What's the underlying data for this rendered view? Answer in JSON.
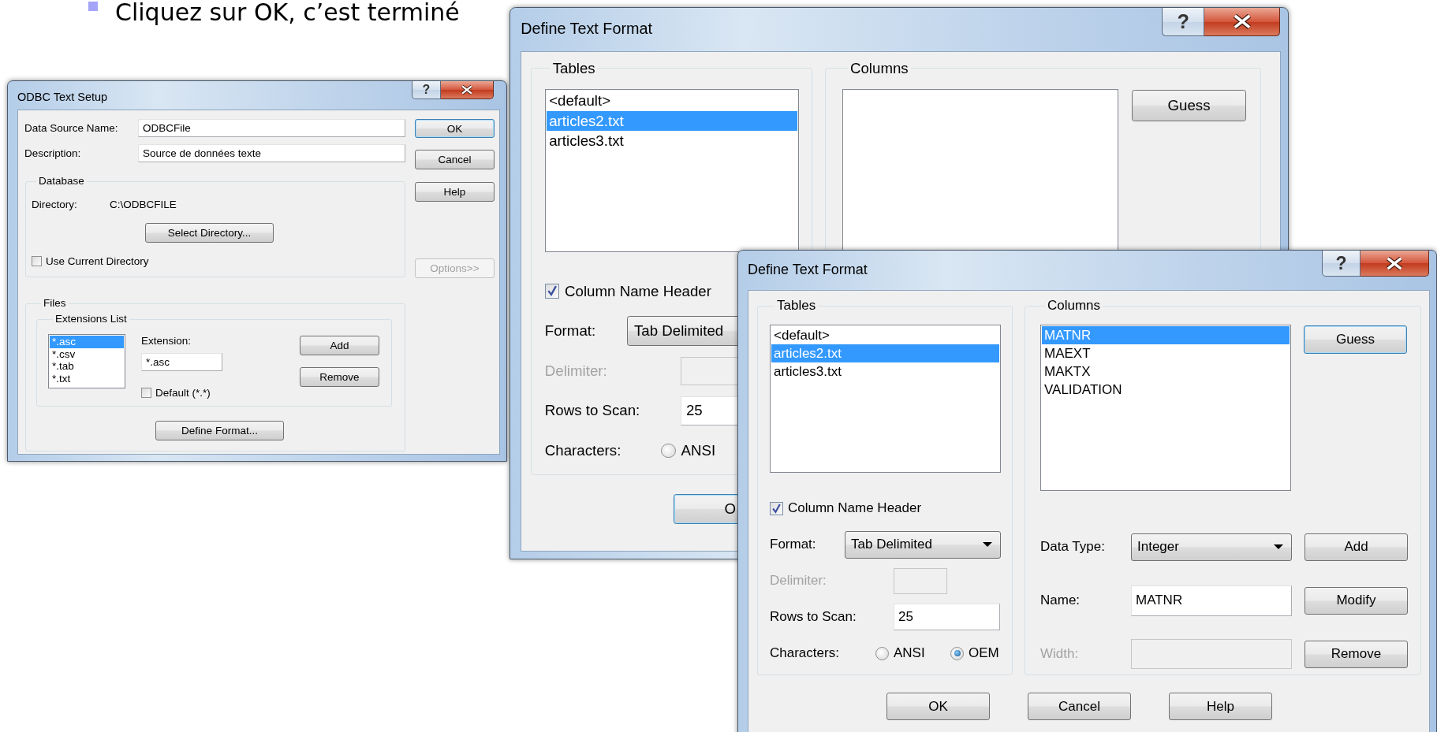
{
  "slide": {
    "bullet_text": "Cliquez sur OK, c’est terminé"
  },
  "odbc_setup": {
    "title": "ODBC Text Setup",
    "help_button": "?",
    "fields": [
      {
        "label": "Data Source Name:",
        "value": "ODBCFile"
      },
      {
        "label": "Description:",
        "value": "Source de données texte"
      }
    ],
    "database": {
      "title": "Database",
      "directory_label": "Directory:",
      "directory": "C:\\ODBCFILE",
      "select_button": {
        "label": "Select Directory...",
        "default": false,
        "disabled": false
      },
      "use_current_directory": {
        "label": "Use Current Directory",
        "checked": false
      }
    },
    "files": {
      "title": "Files",
      "extensions": {
        "title": "Extensions List",
        "items": [
          {
            "label": "*.asc",
            "selected": true
          },
          {
            "label": "*.csv",
            "selected": false
          },
          {
            "label": "*.tab",
            "selected": false
          },
          {
            "label": "*.txt",
            "selected": false
          }
        ],
        "extension_label": "Extension:",
        "extension_value": "*.asc",
        "default_option": {
          "label": "Default (*.*)",
          "checked": false
        },
        "buttons": [
          {
            "label": "Add",
            "default": false,
            "disabled": false
          },
          {
            "label": "Remove",
            "default": false,
            "disabled": false
          }
        ]
      },
      "define_button": {
        "label": "Define Format...",
        "default": false,
        "disabled": false
      }
    },
    "buttons": [
      {
        "label": "OK",
        "default": true,
        "disabled": false
      },
      {
        "label": "Cancel",
        "default": false,
        "disabled": false
      },
      {
        "label": "Help",
        "default": false,
        "disabled": false
      },
      {
        "label": "Options>>",
        "default": false,
        "disabled": true
      }
    ]
  },
  "format_dialog_back": {
    "title": "Define Text Format",
    "help_button": "?",
    "tables": {
      "title": "Tables",
      "items": [
        {
          "label": "<default>",
          "selected": false
        },
        {
          "label": "articles2.txt",
          "selected": true
        },
        {
          "label": "articles3.txt",
          "selected": false
        }
      ]
    },
    "columns": {
      "title": "Columns",
      "guess_button": {
        "label": "Guess",
        "default": false,
        "disabled": false
      }
    },
    "column_name_header": {
      "label": "Column Name Header",
      "checked": true
    },
    "format": {
      "label": "Format:",
      "value": "Tab Delimited"
    },
    "delimiter": {
      "label": "Delimiter:",
      "disabled": true
    },
    "rows_to_scan": {
      "label": "Rows to Scan:",
      "value": "25"
    },
    "characters": {
      "label": "Characters:",
      "options": [
        {
          "label": "ANSI",
          "selected": false
        }
      ]
    },
    "buttons": [
      {
        "label": "O",
        "default": true,
        "disabled": false
      }
    ]
  },
  "format_dialog_front": {
    "title": "Define Text Format",
    "help_button": "?",
    "tables": {
      "title": "Tables",
      "items": [
        {
          "label": "<default>",
          "selected": false
        },
        {
          "label": "articles2.txt",
          "selected": true
        },
        {
          "label": "articles3.txt",
          "selected": false
        }
      ]
    },
    "columns": {
      "title": "Columns",
      "items": [
        {
          "label": "MATNR",
          "selected": true
        },
        {
          "label": "MAEXT",
          "selected": false
        },
        {
          "label": "MAKTX",
          "selected": false
        },
        {
          "label": "VALIDATION",
          "selected": false
        }
      ],
      "guess_button": {
        "label": "Guess",
        "default": true,
        "disabled": false
      }
    },
    "column_name_header": {
      "label": "Column Name Header",
      "checked": true
    },
    "format": {
      "label": "Format:",
      "value": "Tab Delimited"
    },
    "delimiter": {
      "label": "Delimiter:",
      "disabled": true
    },
    "rows_to_scan": {
      "label": "Rows to Scan:",
      "value": "25"
    },
    "characters": {
      "label": "Characters:",
      "options": [
        {
          "label": "ANSI",
          "selected": false
        },
        {
          "label": "OEM",
          "selected": true
        }
      ]
    },
    "column_settings": [
      {
        "kind": "dropdown",
        "label": "Data Type:",
        "value": "Integer",
        "disabled": false,
        "button": {
          "label": "Add",
          "default": false,
          "disabled": false
        }
      },
      {
        "kind": "field",
        "label": "Name:",
        "value": "MATNR",
        "disabled": false,
        "button": {
          "label": "Modify",
          "default": false,
          "disabled": false
        }
      },
      {
        "kind": "field",
        "label": "Width:",
        "disabled": true,
        "button": {
          "label": "Remove",
          "default": false,
          "disabled": false
        }
      }
    ],
    "buttons": [
      {
        "label": "OK",
        "default": false,
        "disabled": false
      },
      {
        "label": "Cancel",
        "default": false,
        "disabled": false
      },
      {
        "label": "Help",
        "default": false,
        "disabled": false
      }
    ]
  }
}
